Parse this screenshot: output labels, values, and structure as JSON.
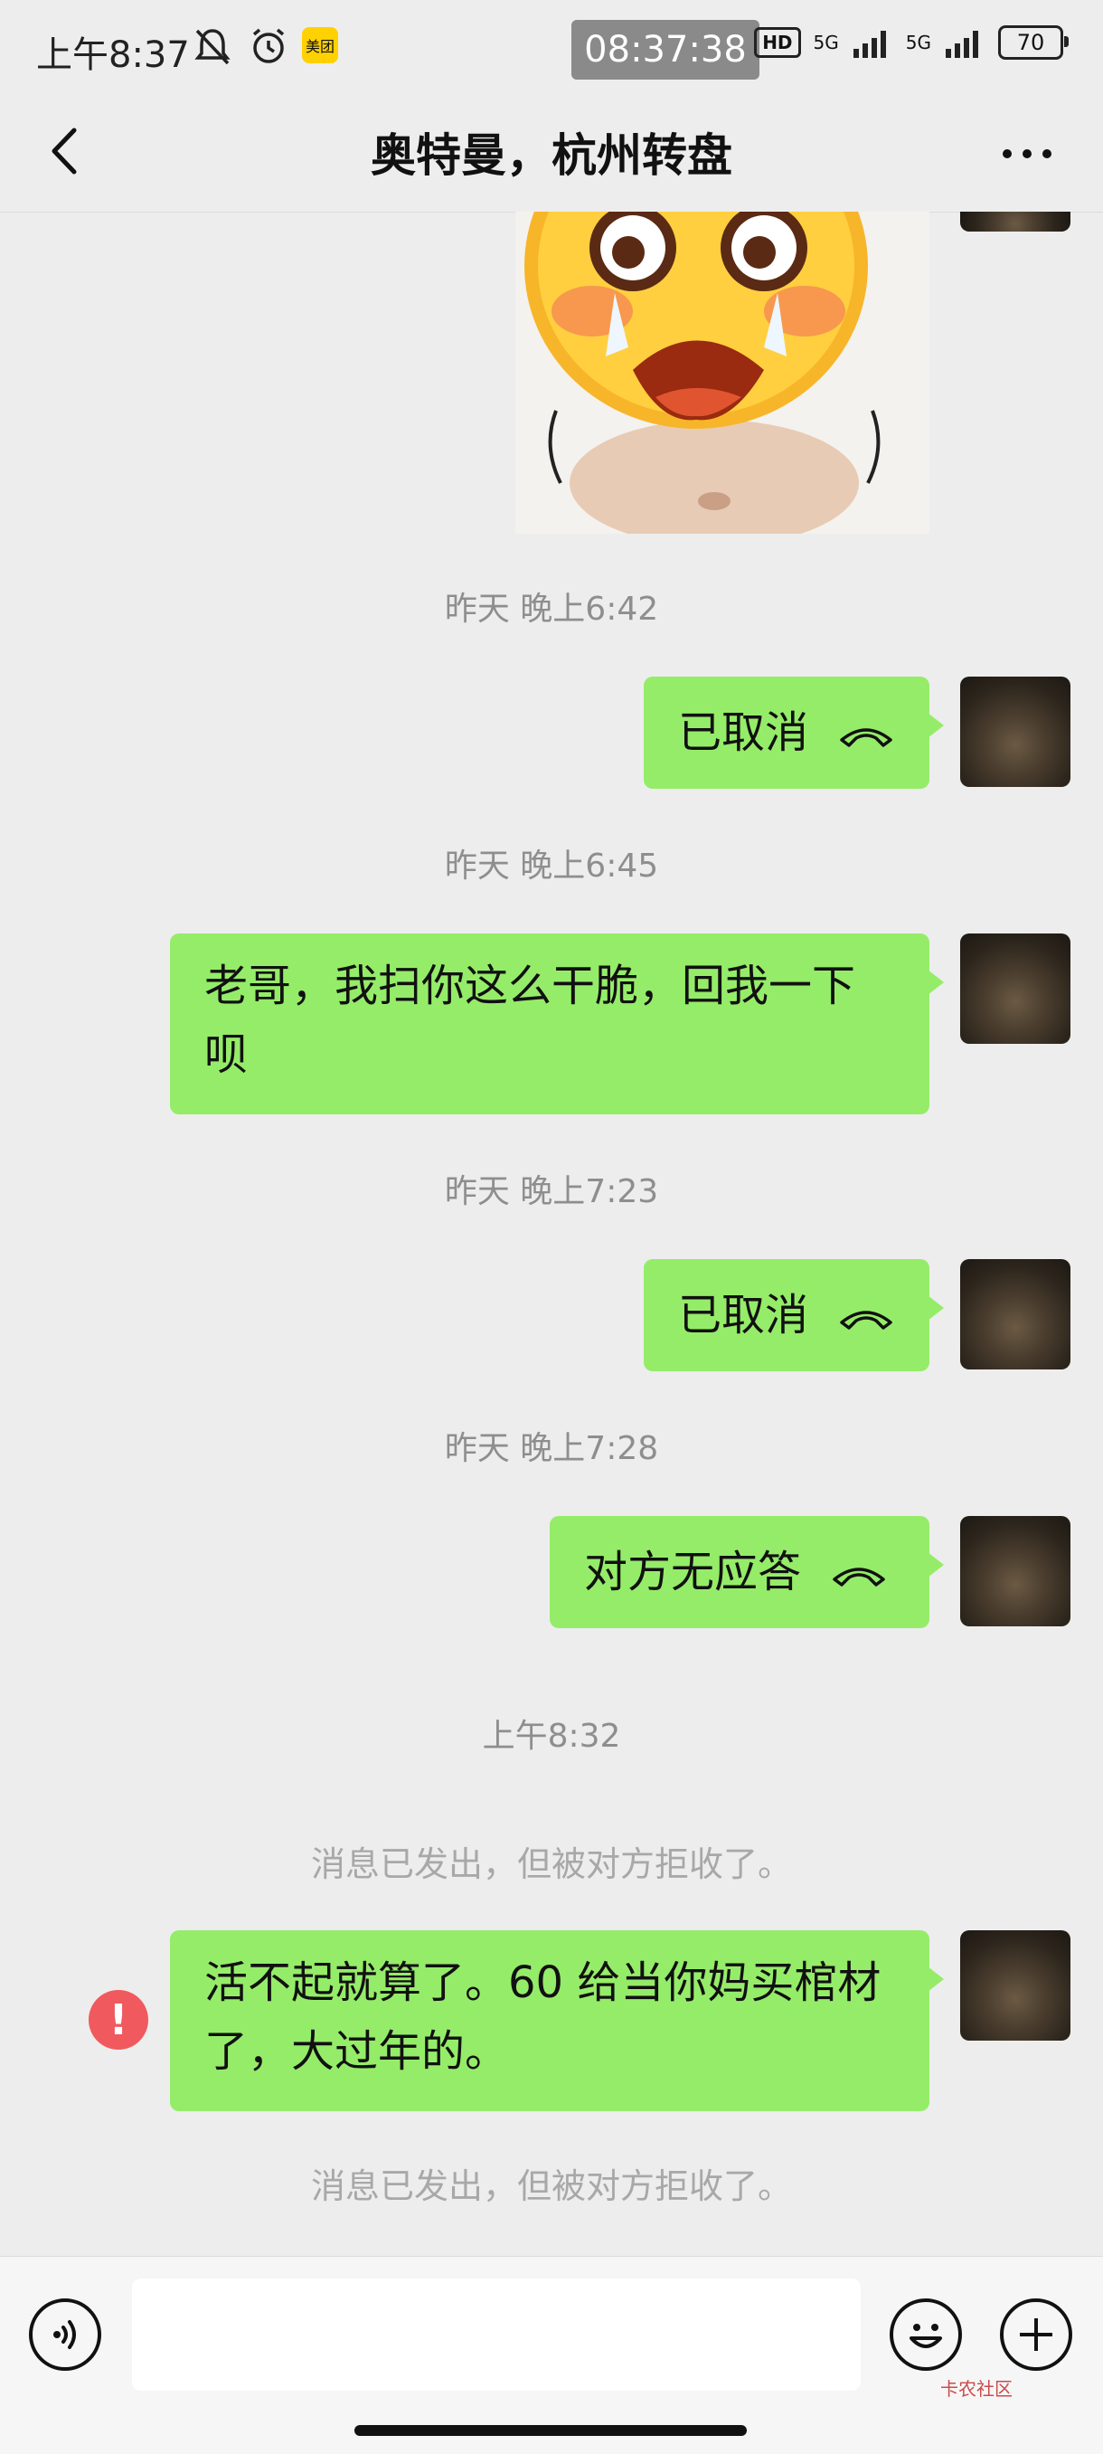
{
  "status_bar": {
    "time": "上午8:37",
    "meituan_label": "美团",
    "clock_overlay": "08:37:38",
    "hd_label": "HD",
    "network_1": "5G",
    "network_2": "5G",
    "battery": "70"
  },
  "header": {
    "title": "奥特曼，杭州转盘"
  },
  "messages": [
    {
      "type": "timestamp",
      "text": "昨天 晚上6:42"
    },
    {
      "type": "call",
      "text": "已取消"
    },
    {
      "type": "timestamp",
      "text": "昨天 晚上6:45"
    },
    {
      "type": "text",
      "text": "老哥，我扫你这么干脆，回我一下呗"
    },
    {
      "type": "timestamp",
      "text": "昨天 晚上7:23"
    },
    {
      "type": "call",
      "text": "已取消"
    },
    {
      "type": "timestamp",
      "text": "昨天 晚上7:28"
    },
    {
      "type": "call",
      "text": "对方无应答"
    },
    {
      "type": "timestamp",
      "text": "上午8:32"
    },
    {
      "type": "notice",
      "text": "消息已发出，但被对方拒收了。"
    },
    {
      "type": "text",
      "text": "活不起就算了。60 给当你妈买棺材了，大过年的。",
      "status": "failed",
      "error_mark": "!"
    },
    {
      "type": "notice",
      "text": "消息已发出，但被对方拒收了。"
    }
  ],
  "bottom_bar": {
    "input_value": "",
    "watermark": "卡农社区"
  },
  "colors": {
    "bubble_green": "#95ec69",
    "background": "#ededed",
    "error_red": "#f0595d"
  },
  "icons": [
    "back-arrow-icon",
    "more-icon",
    "voice-icon",
    "emoji-icon",
    "plus-icon",
    "phone-hangup-icon",
    "error-icon"
  ]
}
